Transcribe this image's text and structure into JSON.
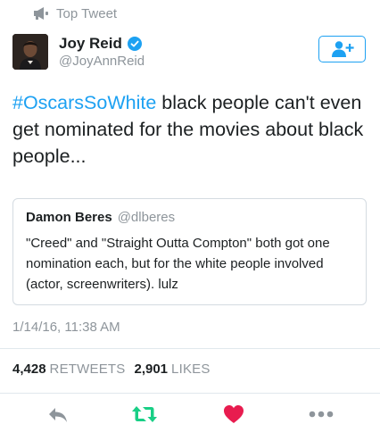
{
  "top_label": "Top Tweet",
  "author": {
    "name": "Joy Reid",
    "handle": "@JoyAnnReid",
    "verified": true
  },
  "tweet": {
    "hashtag": "#OscarsSoWhite",
    "text": " black people can't even get nominated for the movies about black people..."
  },
  "quoted_tweet": {
    "name": "Damon Beres",
    "handle": "@dlberes",
    "text": "\"Creed\" and \"Straight Outta Compton\" both got one nomination each, but for the white people involved (actor, screenwriters). lulz"
  },
  "timestamp": "1/14/16, 11:38 AM",
  "stats": {
    "retweets_count": "4,428",
    "retweets_label": "RETWEETS",
    "likes_count": "2,901",
    "likes_label": "LIKES"
  },
  "actions": [
    "reply-icon",
    "retweet-icon",
    "like-icon",
    "more-icon"
  ],
  "colors": {
    "accent": "#1da1f2",
    "retweet": "#19cf86",
    "like": "#e81c4f",
    "muted": "#8e959b",
    "text": "#1c2022"
  }
}
